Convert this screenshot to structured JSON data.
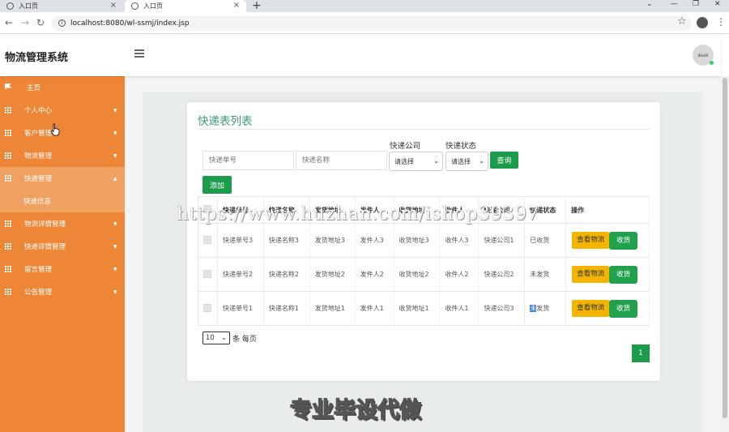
{
  "browser": {
    "tabs": [
      {
        "title": "入口页",
        "active": false
      },
      {
        "title": "入口页",
        "active": true
      }
    ],
    "url": "localhost:8080/wl-ssmj/index.jsp",
    "icons": [
      "back-icon",
      "forward-icon",
      "reload-icon",
      "info-icon",
      "star-icon",
      "profile-icon",
      "kebab-icon"
    ]
  },
  "header": {
    "brand": "物流管理系统",
    "avatar_text": "80x80"
  },
  "sidebar": {
    "items": [
      {
        "label": "主页",
        "icon": "flag-icon",
        "expandable": false
      },
      {
        "label": "个人中心",
        "icon": "grid-icon",
        "expandable": true
      },
      {
        "label": "客户管理",
        "icon": "grid-icon",
        "expandable": true
      },
      {
        "label": "物流管理",
        "icon": "grid-icon",
        "expandable": true
      },
      {
        "label": "快递管理",
        "icon": "grid-icon",
        "expandable": true,
        "expanded": true
      },
      {
        "label": "快递信息",
        "sub": true
      },
      {
        "label": "物流详情管理",
        "icon": "grid-icon",
        "expandable": true
      },
      {
        "label": "快递详情管理",
        "icon": "grid-icon",
        "expandable": true
      },
      {
        "label": "留言管理",
        "icon": "grid-icon",
        "expandable": true
      },
      {
        "label": "公告管理",
        "icon": "grid-icon",
        "expandable": true
      }
    ],
    "bg_color": "#ed8636"
  },
  "card": {
    "title": "快递表列表",
    "search": {
      "number_placeholder": "快递单号",
      "name_placeholder": "快递名称",
      "company_label": "快递公司",
      "company_value": "请选择",
      "status_label": "快递状态",
      "status_value": "请选择",
      "query_label": "查询",
      "add_label": "添加"
    },
    "table": {
      "headers": [
        "快递单号",
        "快递名称",
        "发货地址",
        "发件人",
        "收货地址",
        "收件人",
        "快递公司",
        "快递状态",
        "操作"
      ],
      "rows": [
        {
          "number": "快递单号3",
          "name": "快递名称3",
          "from": "发货地址3",
          "sender": "发件人3",
          "to": "收货地址3",
          "receiver": "收件人3",
          "company": "快递公司1",
          "status": "已收货",
          "view": "查看物流",
          "receive": "收货"
        },
        {
          "number": "快递单号2",
          "name": "快递名称2",
          "from": "发货地址2",
          "sender": "发件人2",
          "to": "收货地址2",
          "receiver": "收件人2",
          "company": "快递公司2",
          "status": "未发货",
          "view": "查看物流",
          "receive": "收货"
        },
        {
          "number": "快递单号1",
          "name": "快递名称1",
          "from": "发货地址1",
          "sender": "发件人1",
          "to": "收货地址1",
          "receiver": "收件人1",
          "company": "快递公司3",
          "status_a": "未",
          "status_b": "发货",
          "view": "查看物流",
          "receive": "收货"
        }
      ]
    },
    "pagination": {
      "page_size": "10",
      "per_page": "条 每页",
      "current_page": "1"
    }
  },
  "overlay": {
    "watermark": "https://www.huzhan.com/ishop39397",
    "promo": "专业毕设代做"
  },
  "colors": {
    "accent": "#1c9b4b",
    "title": "#3c9a72",
    "warn": "#f4b400"
  }
}
